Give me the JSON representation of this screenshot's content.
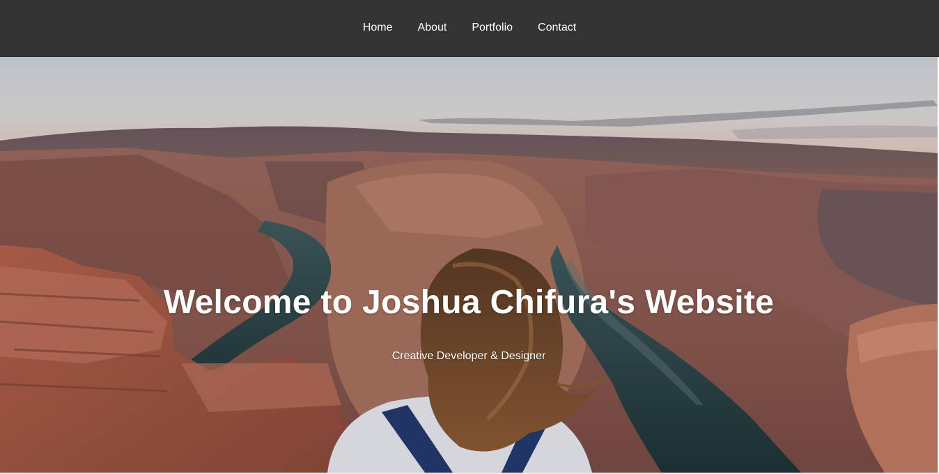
{
  "nav": {
    "items": [
      {
        "label": "Home"
      },
      {
        "label": "About"
      },
      {
        "label": "Portfolio"
      },
      {
        "label": "Contact"
      }
    ]
  },
  "hero": {
    "title": "Welcome to Joshua Chifura's Website",
    "subtitle": "Creative Developer & Designer",
    "background_image": "canyon-overlook-photo"
  },
  "colors": {
    "nav_background": "#333333",
    "nav_text": "#ffffff",
    "hero_text": "#ffffff"
  }
}
